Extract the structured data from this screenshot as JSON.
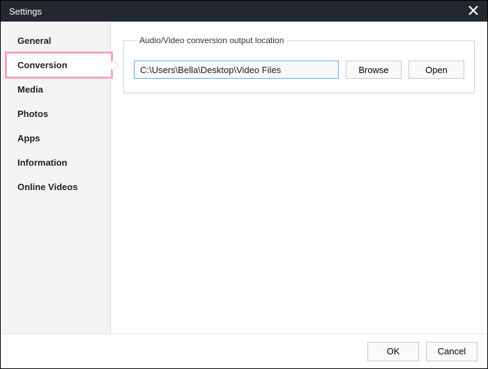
{
  "window": {
    "title": "Settings"
  },
  "sidebar": {
    "items": [
      {
        "label": "General"
      },
      {
        "label": "Conversion"
      },
      {
        "label": "Media"
      },
      {
        "label": "Photos"
      },
      {
        "label": "Apps"
      },
      {
        "label": "Information"
      },
      {
        "label": "Online Videos"
      }
    ],
    "activeIndex": 1
  },
  "group": {
    "legend": "Audio/Video conversion output location",
    "path": "C:\\Users\\Bella\\Desktop\\Video Files",
    "browse": "Browse",
    "open": "Open"
  },
  "footer": {
    "ok": "OK",
    "cancel": "Cancel"
  }
}
